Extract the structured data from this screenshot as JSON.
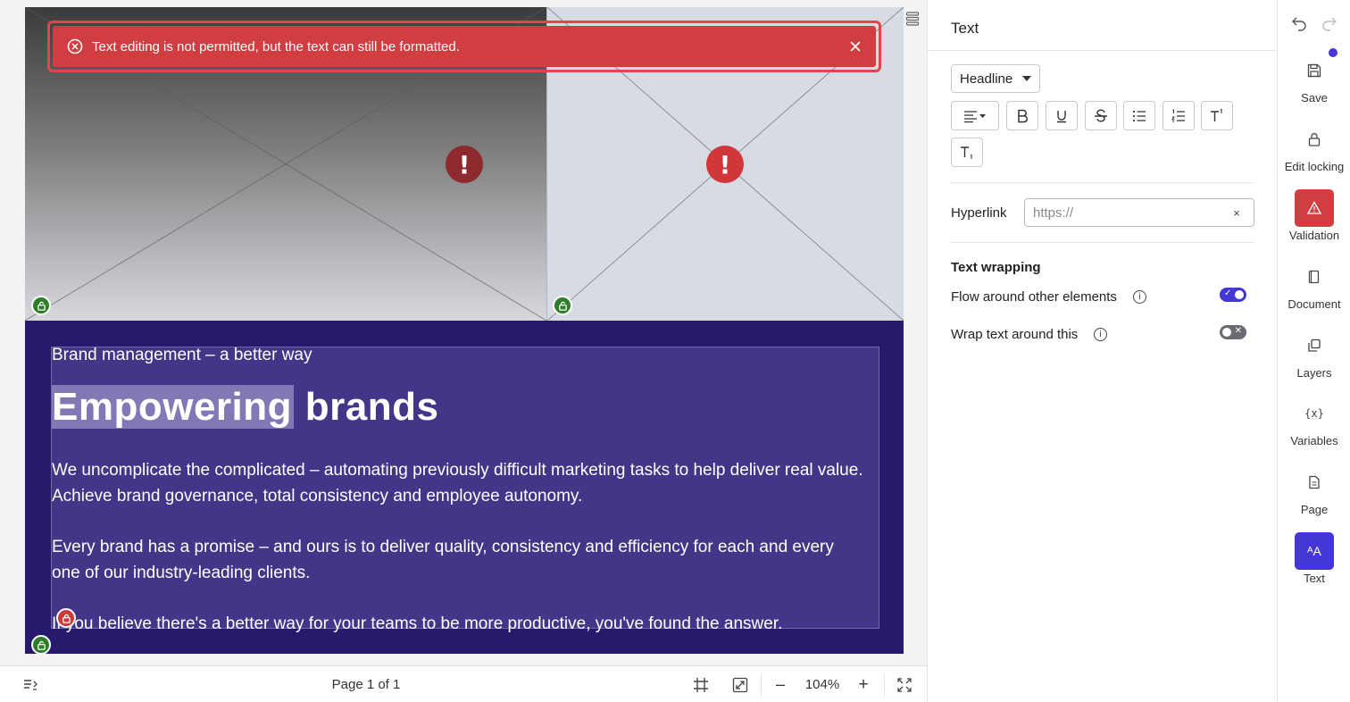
{
  "toast": {
    "message": "Text editing is not permitted, but the text can still be formatted."
  },
  "canvas": {
    "text_block": {
      "subtitle": "Brand management – a better way",
      "title_selected": "Empowering",
      "title_rest": " brands",
      "paragraph1": "We uncomplicate the complicated – automating previously difficult marketing tasks to help deliver real value. Achieve brand governance, total consistency and employee autonomy.",
      "paragraph2": "Every brand has a promise – and ours is to deliver quality, consistency and efficiency for each and every one of our industry-leading clients.",
      "paragraph3": "If you believe there's a better way for your teams to be more productive, you've found the answer."
    },
    "error_icon_glyph": "!"
  },
  "bottom_bar": {
    "page_indicator": "Page 1 of 1",
    "zoom_level": "104%",
    "zoom_out": "–",
    "zoom_in": "+"
  },
  "properties": {
    "title": "Text",
    "style_dropdown": "Headline",
    "hyperlink_label": "Hyperlink",
    "hyperlink_placeholder": "https://",
    "hyperlink_clear": "×",
    "text_wrapping_title": "Text wrapping",
    "flow_around_label": "Flow around other elements",
    "flow_around_on": true,
    "wrap_text_label": "Wrap text around this",
    "wrap_text_on": false,
    "info_glyph": "i",
    "toggle_on_mark": "✓",
    "toggle_off_mark": "✕"
  },
  "rail": {
    "items": [
      {
        "label": "Save",
        "icon": "save-icon"
      },
      {
        "label": "Edit locking",
        "icon": "lock-icon"
      },
      {
        "label": "Validation",
        "icon": "warning-icon"
      },
      {
        "label": "Document",
        "icon": "document-icon"
      },
      {
        "label": "Layers",
        "icon": "layers-icon"
      },
      {
        "label": "Variables",
        "icon": "variables-icon"
      },
      {
        "label": "Page",
        "icon": "page-icon"
      },
      {
        "label": "Text",
        "icon": "text-icon"
      }
    ],
    "variables_glyph": "{x}",
    "text_glyph": "ᴬA"
  },
  "colors": {
    "accent": "#4536d6",
    "error": "#d13e42",
    "text_block_bg": "#271a6c",
    "lock_green": "#2f7d2a"
  }
}
